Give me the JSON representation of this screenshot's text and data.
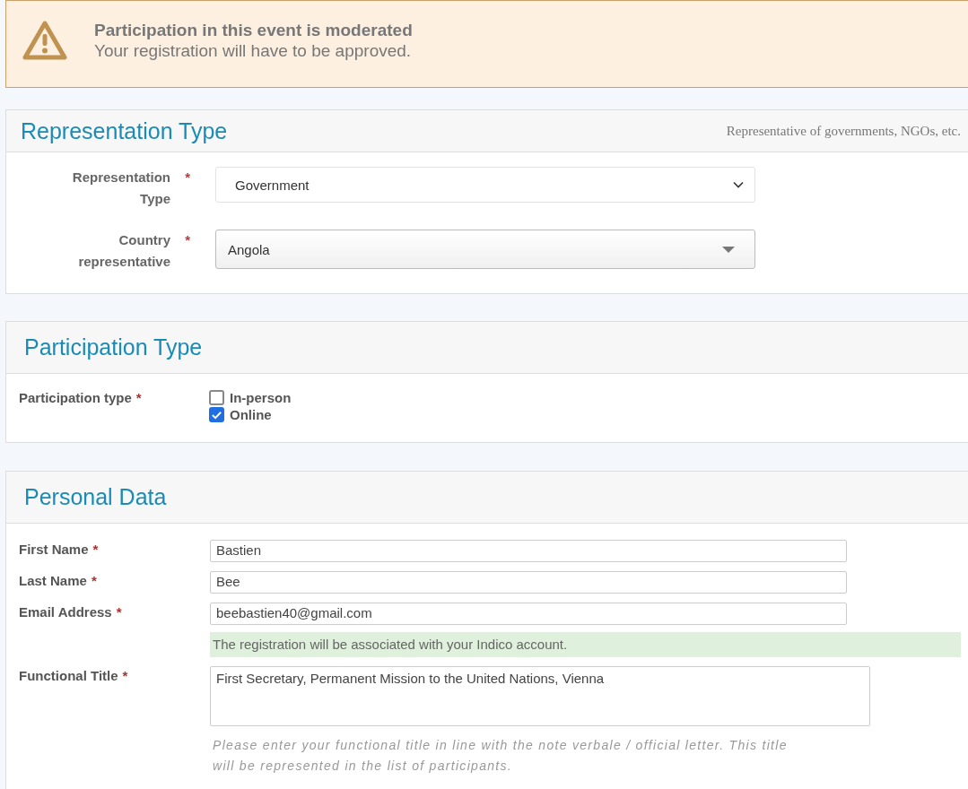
{
  "alert": {
    "title": "Participation in this event is moderated",
    "message": "Your registration will have to be approved."
  },
  "representation": {
    "title": "Representation Type",
    "description": "Representative of governments, NGOs, etc.",
    "fields": [
      {
        "kind": "select",
        "label": "Representation Type",
        "required_mark": "*",
        "value": "Government"
      },
      {
        "kind": "combo",
        "label": "Country representative",
        "required_mark": "*",
        "value": "Angola"
      }
    ]
  },
  "participation": {
    "title": "Participation Type",
    "label": "Participation type",
    "required_mark": "*",
    "options": [
      {
        "label": "In-person",
        "checked": false
      },
      {
        "label": "Online",
        "checked": true
      }
    ]
  },
  "personal": {
    "title": "Personal Data",
    "fields": [
      {
        "kind": "input",
        "label": "First Name",
        "required_mark": "*",
        "value": "Bastien"
      },
      {
        "kind": "input",
        "label": "Last Name",
        "required_mark": "*",
        "value": "Bee"
      },
      {
        "kind": "input",
        "label": "Email Address",
        "required_mark": "*",
        "value": "beebastien40@gmail.com",
        "note": "The registration will be associated with your Indico account."
      },
      {
        "kind": "textarea",
        "label": "Functional Title",
        "required_mark": "*",
        "value": "First Secretary, Permanent Mission to the United Nations, Vienna",
        "help": "Please enter your functional title in line with the note verbale / official letter. This title will be represented in the list of participants."
      }
    ]
  }
}
